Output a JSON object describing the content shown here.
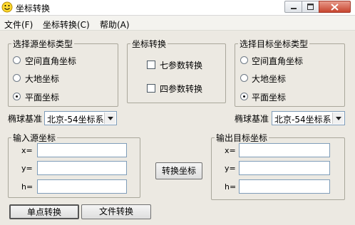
{
  "window": {
    "title": "坐标转换"
  },
  "menu": [
    "文件(F)",
    "坐标转换(C)",
    "帮助(A)"
  ],
  "source_type": {
    "title": "选择源坐标类型",
    "options": [
      "空间直角坐标",
      "大地坐标",
      "平面坐标"
    ],
    "selected_index": 2
  },
  "transform": {
    "title": "坐标转换",
    "options": [
      "七参数转换",
      "四参数转换"
    ]
  },
  "target_type": {
    "title": "选择目标坐标类型",
    "options": [
      "空间直角坐标",
      "大地坐标",
      "平面坐标"
    ],
    "selected_index": 2
  },
  "ellipsoid_source": {
    "label": "椭球基准",
    "value": "北京-54坐标系"
  },
  "ellipsoid_target": {
    "label": "椭球基准",
    "value": "北京-54坐标系"
  },
  "input_coords": {
    "title": "输入源坐标",
    "fields": [
      "x=",
      "y=",
      "h="
    ]
  },
  "output_coords": {
    "title": "输出目标坐标",
    "fields": [
      "x=",
      "y=",
      "h="
    ]
  },
  "convert_button": "转换坐标",
  "mode_buttons": [
    "单点转换",
    "文件转换"
  ]
}
